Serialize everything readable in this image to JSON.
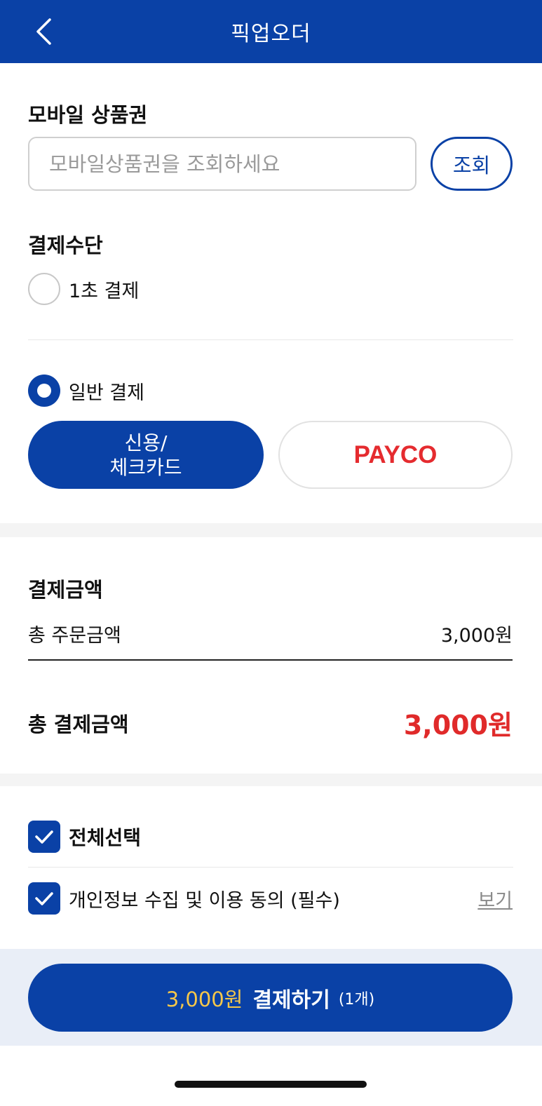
{
  "header": {
    "title": "픽업오더",
    "back_icon": "chevron-left-icon"
  },
  "gift_card": {
    "title": "모바일 상품권",
    "placeholder": "모바일상품권을 조회하세요",
    "lookup_label": "조회"
  },
  "payment_method": {
    "title": "결제수단",
    "one_second_label": "1초 결제",
    "general_label": "일반 결제",
    "card_label": "신용/\n체크카드",
    "payco_label": "PAYCO"
  },
  "payment_amount": {
    "title": "결제금액",
    "order_total_label": "총 주문금액",
    "order_total_value": "3,000원",
    "pay_total_label": "총 결제금액",
    "pay_total_value": "3,000원"
  },
  "agreements": {
    "select_all_label": "전체선택",
    "privacy_label": "개인정보 수집 및 이용 동의 (필수)",
    "view_label": "보기"
  },
  "cta": {
    "amount": "3,000원",
    "label": "결제하기",
    "count": "(1개)"
  },
  "colors": {
    "primary": "#0a41a6",
    "accent_yellow": "#f5c74a",
    "total_red": "#e02a2a",
    "payco_red": "#e52b2f"
  }
}
